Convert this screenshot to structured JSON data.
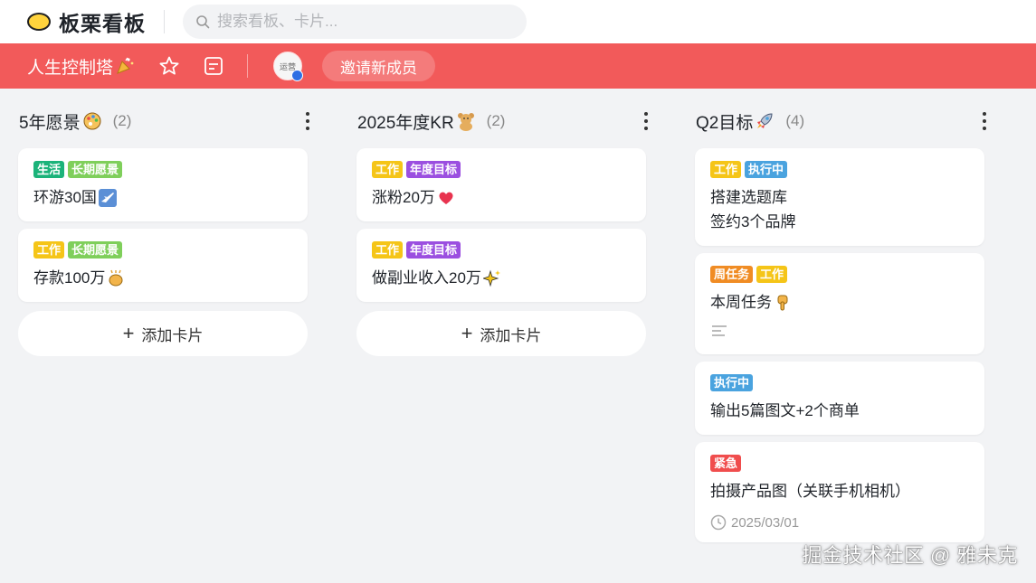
{
  "app": {
    "name": "板栗看板"
  },
  "search": {
    "placeholder": "搜索看板、卡片..."
  },
  "board": {
    "name": "人生控制塔",
    "avatar_text": "运营",
    "invite_label": "邀请新成员"
  },
  "add_card_label": "添加卡片",
  "columns": [
    {
      "title": "5年愿景",
      "count": "(2)",
      "cards": [
        {
          "tags": [
            {
              "label": "生活",
              "color": "#1bb37a"
            },
            {
              "label": "长期愿景",
              "color": "#7fcf5b"
            }
          ],
          "title": "环游30国"
        },
        {
          "tags": [
            {
              "label": "工作",
              "color": "#f5c518"
            },
            {
              "label": "长期愿景",
              "color": "#7fcf5b"
            }
          ],
          "title": "存款100万"
        }
      ]
    },
    {
      "title": "2025年度KR",
      "count": "(2)",
      "cards": [
        {
          "tags": [
            {
              "label": "工作",
              "color": "#f5c518"
            },
            {
              "label": "年度目标",
              "color": "#9b4fe0"
            }
          ],
          "title": "涨粉20万"
        },
        {
          "tags": [
            {
              "label": "工作",
              "color": "#f5c518"
            },
            {
              "label": "年度目标",
              "color": "#9b4fe0"
            }
          ],
          "title": "做副业收入20万"
        }
      ]
    },
    {
      "title": "Q2目标",
      "count": "(4)",
      "cards": [
        {
          "tags": [
            {
              "label": "工作",
              "color": "#f5c518"
            },
            {
              "label": "执行中",
              "color": "#4aa3df"
            }
          ],
          "lines": [
            "搭建选题库",
            "签约3个品牌"
          ]
        },
        {
          "tags": [
            {
              "label": "周任务",
              "color": "#f08c24"
            },
            {
              "label": "工作",
              "color": "#f5c518"
            }
          ],
          "title": "本周任务"
        },
        {
          "tags": [
            {
              "label": "执行中",
              "color": "#4aa3df"
            }
          ],
          "title": "输出5篇图文+2个商单"
        },
        {
          "tags": [
            {
              "label": "紧急",
              "color": "#f04d4d"
            }
          ],
          "title": "拍摄产品图（关联手机相机）",
          "due": "2025/03/01"
        }
      ]
    }
  ],
  "watermark": "掘金技术社区 @ 雅未克",
  "colors": {
    "header_red": "#f25a5a",
    "logo_yellow": "#ffd33d"
  }
}
